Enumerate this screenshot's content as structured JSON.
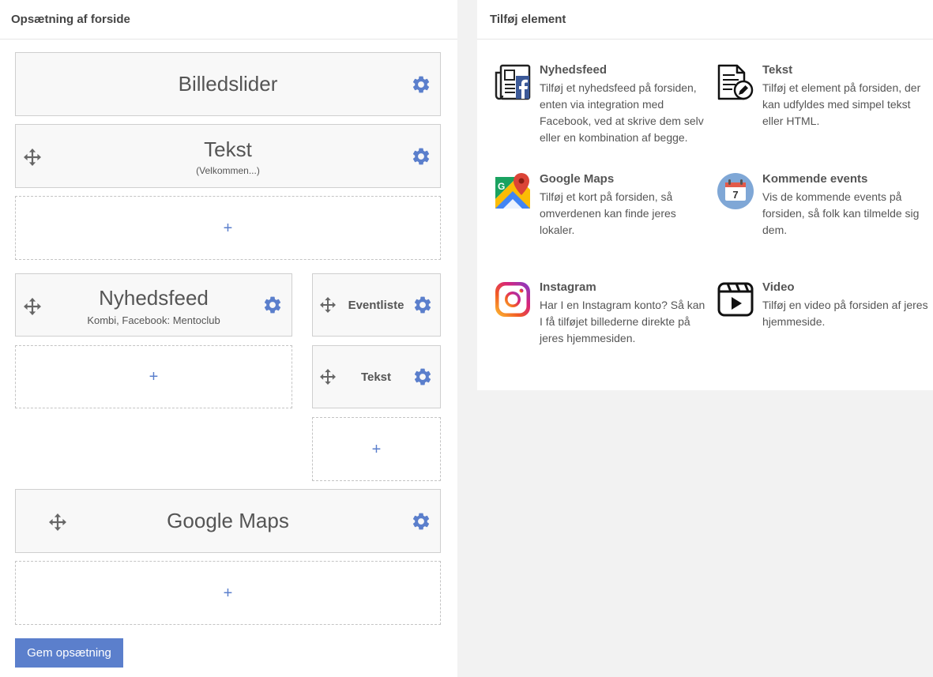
{
  "left_panel": {
    "title": "Opsætning af forside",
    "blocks": {
      "billedslider": {
        "title": "Billedslider"
      },
      "tekst_top": {
        "title": "Tekst",
        "subtitle": "(Velkommen...)"
      },
      "nyhedsfeed": {
        "title": "Nyhedsfeed",
        "subtitle": "Kombi, Facebook: Mentoclub"
      },
      "eventliste": {
        "title": "Eventliste"
      },
      "tekst_small": {
        "title": "Tekst"
      },
      "google_maps": {
        "title": "Google Maps"
      }
    },
    "add_symbol": "+",
    "save_label": "Gem opsætning"
  },
  "right_panel": {
    "title": "Tilføj element",
    "elements": [
      {
        "title": "Nyhedsfeed",
        "description": "Tilføj et nyhedsfeed på forsiden, enten via integration med Facebook, ved at skrive dem selv eller en kombination af begge.",
        "icon": "newspaper-facebook-icon"
      },
      {
        "title": "Tekst",
        "description": "Tilføj et element på forsiden, der kan udfyldes med simpel tekst eller HTML.",
        "icon": "document-edit-icon"
      },
      {
        "title": "Google Maps",
        "description": "Tilføj et kort på forsiden, så omverdenen kan finde jeres lokaler.",
        "icon": "google-maps-icon"
      },
      {
        "title": "Kommende events",
        "description": "Vis de kommende events på forsiden, så folk kan tilmelde sig dem.",
        "icon": "calendar-icon",
        "calendar_day": "7"
      },
      {
        "title": "Instagram",
        "description": "Har I en Instagram konto? Så kan I få tilføjet billederne direkte på jeres hjemmesiden.",
        "icon": "instagram-icon"
      },
      {
        "title": "Video",
        "description": "Tilføj en video på forsiden af jeres hjemmeside.",
        "icon": "video-clapper-icon"
      }
    ]
  },
  "colors": {
    "accent": "#5b7fcc",
    "icon_gray": "#666666",
    "panel_bg": "#ffffff",
    "page_bg": "#f2f2f2"
  }
}
